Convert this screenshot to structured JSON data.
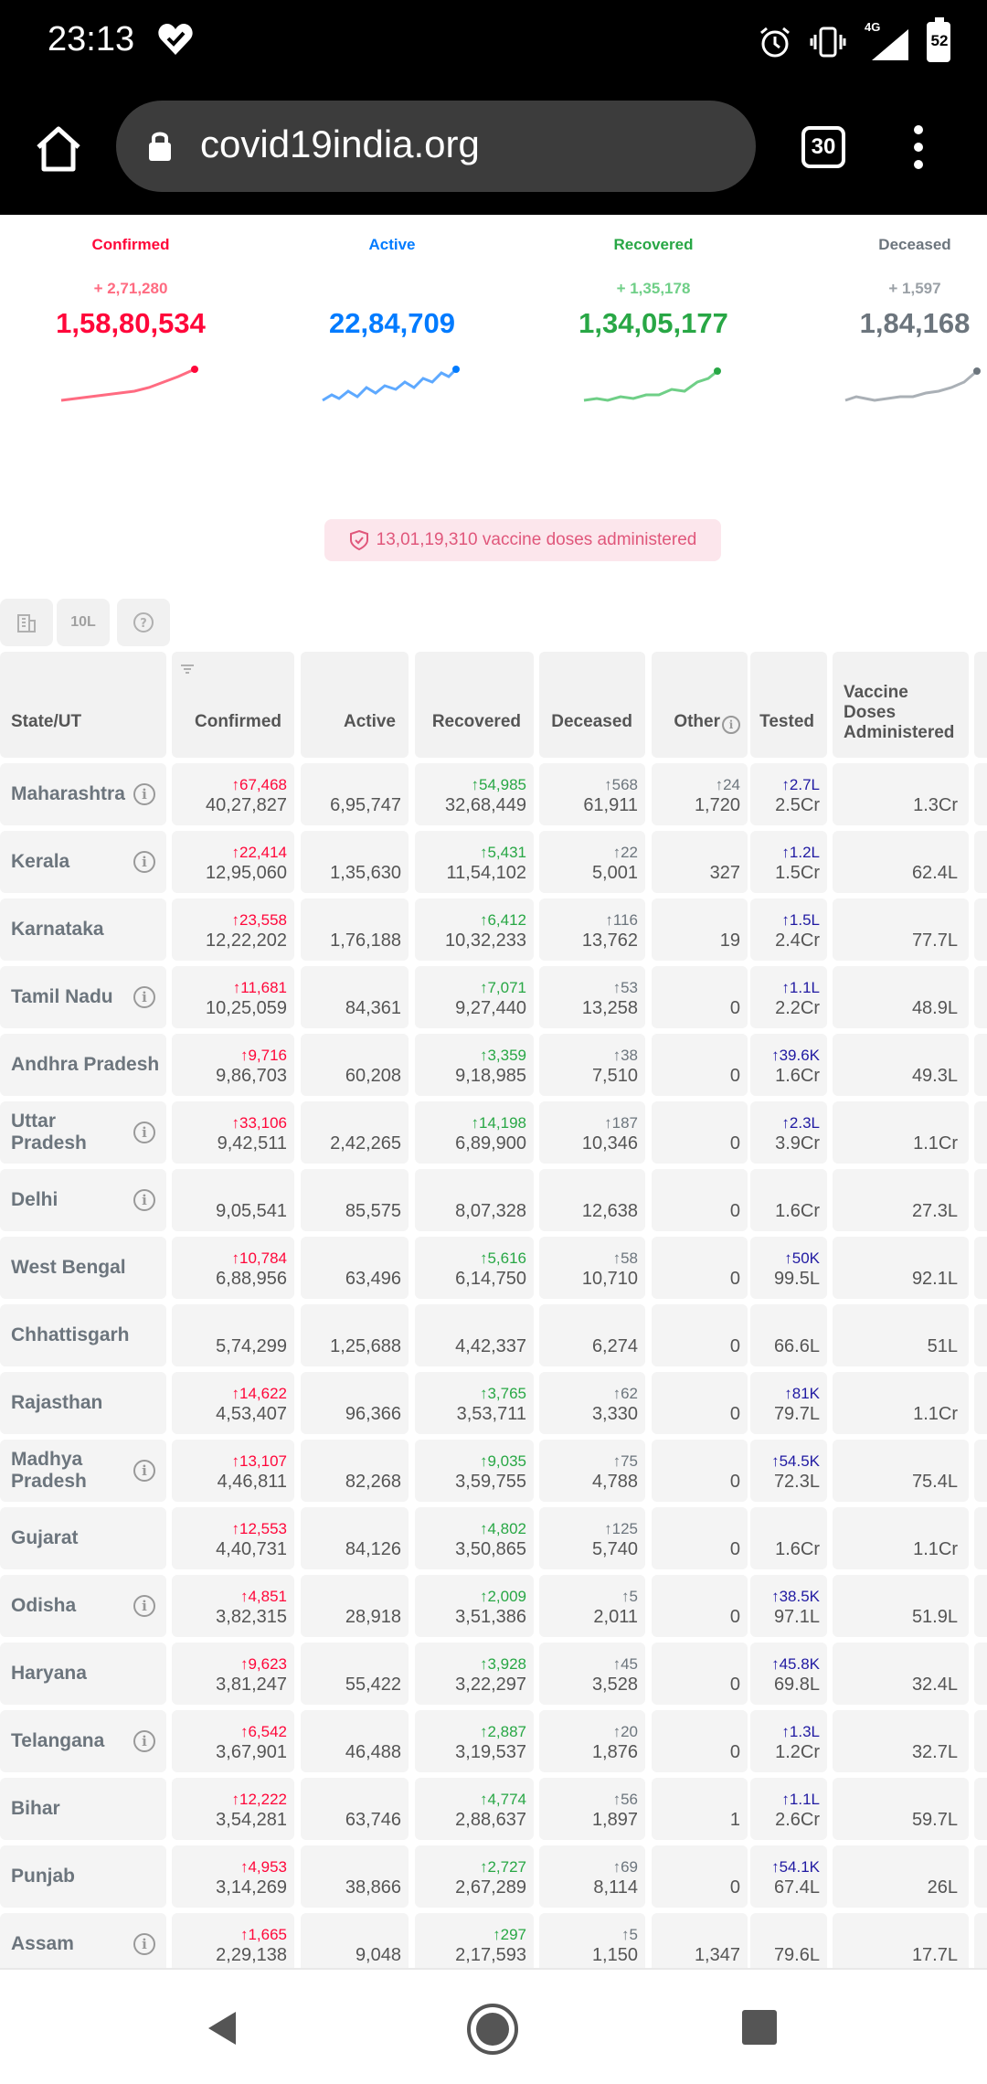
{
  "status_bar": {
    "time": "23:13",
    "network": "4G",
    "battery": "52"
  },
  "browser": {
    "url": "covid19india.org",
    "tab_count": "30"
  },
  "stats": [
    {
      "label": "Confirmed",
      "delta": "+ 2,71,280",
      "total": "1,58,80,534",
      "color": "#ff073a"
    },
    {
      "label": "Active",
      "delta": "",
      "total": "22,84,709",
      "color": "#007bff"
    },
    {
      "label": "Recovered",
      "delta": "+ 1,35,178",
      "total": "1,34,05,177",
      "color": "#28a745"
    },
    {
      "label": "Deceased",
      "delta": "+ 1,597",
      "total": "1,84,168",
      "color": "#6c757d"
    }
  ],
  "vaccine_badge": "13,01,19,310 vaccine doses administered",
  "controls": {
    "per_million_label": "10L"
  },
  "table": {
    "headers": {
      "state": "State/UT",
      "confirmed": "Confirmed",
      "active": "Active",
      "recovered": "Recovered",
      "deceased": "Deceased",
      "other": "Other",
      "tested": "Tested",
      "vaccine_l1": "Vaccine",
      "vaccine_l2": "Doses",
      "vaccine_l3": "Administered"
    },
    "rows": [
      {
        "state": "Maharashtra",
        "info": true,
        "c_d": "67,468",
        "c": "40,27,827",
        "a": "6,95,747",
        "r_d": "54,985",
        "r": "32,68,449",
        "de_d": "568",
        "de": "61,911",
        "o_d": "24",
        "o": "1,720",
        "t_d": "2.7L",
        "t": "2.5Cr",
        "v": "1.3Cr"
      },
      {
        "state": "Kerala",
        "info": true,
        "c_d": "22,414",
        "c": "12,95,060",
        "a": "1,35,630",
        "r_d": "5,431",
        "r": "11,54,102",
        "de_d": "22",
        "de": "5,001",
        "o_d": "",
        "o": "327",
        "t_d": "1.2L",
        "t": "1.5Cr",
        "v": "62.4L"
      },
      {
        "state": "Karnataka",
        "info": false,
        "c_d": "23,558",
        "c": "12,22,202",
        "a": "1,76,188",
        "r_d": "6,412",
        "r": "10,32,233",
        "de_d": "116",
        "de": "13,762",
        "o_d": "",
        "o": "19",
        "t_d": "1.5L",
        "t": "2.4Cr",
        "v": "77.7L"
      },
      {
        "state": "Tamil Nadu",
        "info": true,
        "c_d": "11,681",
        "c": "10,25,059",
        "a": "84,361",
        "r_d": "7,071",
        "r": "9,27,440",
        "de_d": "53",
        "de": "13,258",
        "o_d": "",
        "o": "0",
        "t_d": "1.1L",
        "t": "2.2Cr",
        "v": "48.9L"
      },
      {
        "state": "Andhra Pradesh",
        "info": false,
        "c_d": "9,716",
        "c": "9,86,703",
        "a": "60,208",
        "r_d": "3,359",
        "r": "9,18,985",
        "de_d": "38",
        "de": "7,510",
        "o_d": "",
        "o": "0",
        "t_d": "39.6K",
        "t": "1.6Cr",
        "v": "49.3L"
      },
      {
        "state": "Uttar Pradesh",
        "state_l1": "Uttar",
        "state_l2": "Pradesh",
        "info": true,
        "c_d": "33,106",
        "c": "9,42,511",
        "a": "2,42,265",
        "r_d": "14,198",
        "r": "6,89,900",
        "de_d": "187",
        "de": "10,346",
        "o_d": "",
        "o": "0",
        "t_d": "2.3L",
        "t": "3.9Cr",
        "v": "1.1Cr"
      },
      {
        "state": "Delhi",
        "info": true,
        "c_d": "",
        "c": "9,05,541",
        "a": "85,575",
        "r_d": "",
        "r": "8,07,328",
        "de_d": "",
        "de": "12,638",
        "o_d": "",
        "o": "0",
        "t_d": "",
        "t": "1.6Cr",
        "v": "27.3L"
      },
      {
        "state": "West Bengal",
        "info": false,
        "c_d": "10,784",
        "c": "6,88,956",
        "a": "63,496",
        "r_d": "5,616",
        "r": "6,14,750",
        "de_d": "58",
        "de": "10,710",
        "o_d": "",
        "o": "0",
        "t_d": "50K",
        "t": "99.5L",
        "v": "92.1L"
      },
      {
        "state": "Chhattisgarh",
        "info": false,
        "c_d": "",
        "c": "5,74,299",
        "a": "1,25,688",
        "r_d": "",
        "r": "4,42,337",
        "de_d": "",
        "de": "6,274",
        "o_d": "",
        "o": "0",
        "t_d": "",
        "t": "66.6L",
        "v": "51L"
      },
      {
        "state": "Rajasthan",
        "info": false,
        "c_d": "14,622",
        "c": "4,53,407",
        "a": "96,366",
        "r_d": "3,765",
        "r": "3,53,711",
        "de_d": "62",
        "de": "3,330",
        "o_d": "",
        "o": "0",
        "t_d": "81K",
        "t": "79.7L",
        "v": "1.1Cr"
      },
      {
        "state": "Madhya Pradesh",
        "state_l1": "Madhya",
        "state_l2": "Pradesh",
        "info": true,
        "c_d": "13,107",
        "c": "4,46,811",
        "a": "82,268",
        "r_d": "9,035",
        "r": "3,59,755",
        "de_d": "75",
        "de": "4,788",
        "o_d": "",
        "o": "0",
        "t_d": "54.5K",
        "t": "72.3L",
        "v": "75.4L"
      },
      {
        "state": "Gujarat",
        "info": false,
        "c_d": "12,553",
        "c": "4,40,731",
        "a": "84,126",
        "r_d": "4,802",
        "r": "3,50,865",
        "de_d": "125",
        "de": "5,740",
        "o_d": "",
        "o": "0",
        "t_d": "",
        "t": "1.6Cr",
        "v": "1.1Cr"
      },
      {
        "state": "Odisha",
        "info": true,
        "c_d": "4,851",
        "c": "3,82,315",
        "a": "28,918",
        "r_d": "2,009",
        "r": "3,51,386",
        "de_d": "5",
        "de": "2,011",
        "o_d": "",
        "o": "0",
        "t_d": "38.5K",
        "t": "97.1L",
        "v": "51.9L"
      },
      {
        "state": "Haryana",
        "info": false,
        "c_d": "9,623",
        "c": "3,81,247",
        "a": "55,422",
        "r_d": "3,928",
        "r": "3,22,297",
        "de_d": "45",
        "de": "3,528",
        "o_d": "",
        "o": "0",
        "t_d": "45.8K",
        "t": "69.8L",
        "v": "32.4L"
      },
      {
        "state": "Telangana",
        "info": true,
        "c_d": "6,542",
        "c": "3,67,901",
        "a": "46,488",
        "r_d": "2,887",
        "r": "3,19,537",
        "de_d": "20",
        "de": "1,876",
        "o_d": "",
        "o": "0",
        "t_d": "1.3L",
        "t": "1.2Cr",
        "v": "32.7L"
      },
      {
        "state": "Bihar",
        "info": false,
        "c_d": "12,222",
        "c": "3,54,281",
        "a": "63,746",
        "r_d": "4,774",
        "r": "2,88,637",
        "de_d": "56",
        "de": "1,897",
        "o_d": "",
        "o": "1",
        "t_d": "1.1L",
        "t": "2.6Cr",
        "v": "59.7L"
      },
      {
        "state": "Punjab",
        "info": false,
        "c_d": "4,953",
        "c": "3,14,269",
        "a": "38,866",
        "r_d": "2,727",
        "r": "2,67,289",
        "de_d": "69",
        "de": "8,114",
        "o_d": "",
        "o": "0",
        "t_d": "54.1K",
        "t": "67.4L",
        "v": "26L"
      },
      {
        "state": "Assam",
        "info": true,
        "c_d": "1,665",
        "c": "2,29,138",
        "a": "9,048",
        "r_d": "297",
        "r": "2,17,593",
        "de_d": "5",
        "de": "1,150",
        "o_d": "",
        "o": "1,347",
        "t_d": "",
        "t": "79.6L",
        "v": "17.7L"
      }
    ]
  }
}
